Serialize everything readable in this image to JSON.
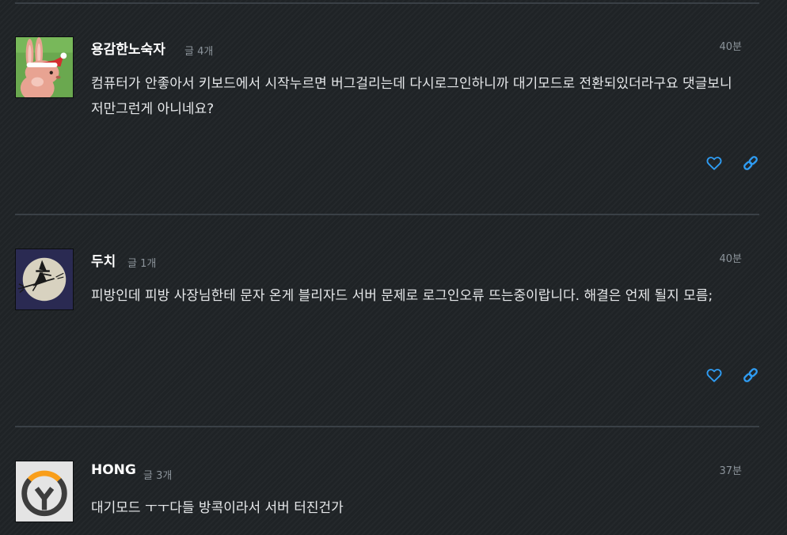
{
  "colors": {
    "background": "#1f2326",
    "divider": "#3a4046",
    "text": "#e6e8ea",
    "muted": "#8c949b",
    "accent": "#2f9df4"
  },
  "posts": [
    {
      "author": "용감한노숙자",
      "post_count": "글 4개",
      "time": "40분",
      "text": "컴퓨터가 안좋아서 키보드에서 시작누르면 버그걸리는데 다시로그인하니까 대기모드로 전환되있더라구요 댓글보니 저만그런게 아니네요?",
      "avatar_icon": "rabbit-santa-hat-icon",
      "like_icon": "heart-icon",
      "link_icon": "link-icon"
    },
    {
      "author": "두치",
      "post_count": "글 1개",
      "time": "40분",
      "text": "피방인데 피방 사장님한테 문자 온게 블리자드 서버 문제로 로그인오류 뜨는중이랍니다. 해결은 언제 될지 모름;",
      "avatar_icon": "witch-moon-icon",
      "like_icon": "heart-icon",
      "link_icon": "link-icon"
    },
    {
      "author": "HONG",
      "post_count": "글 3개",
      "time": "37분",
      "text": "대기모드 ㅜㅜ다들 방콕이라서 서버 터진건가",
      "avatar_icon": "overwatch-logo-icon",
      "like_icon": "heart-icon",
      "link_icon": "link-icon"
    }
  ]
}
